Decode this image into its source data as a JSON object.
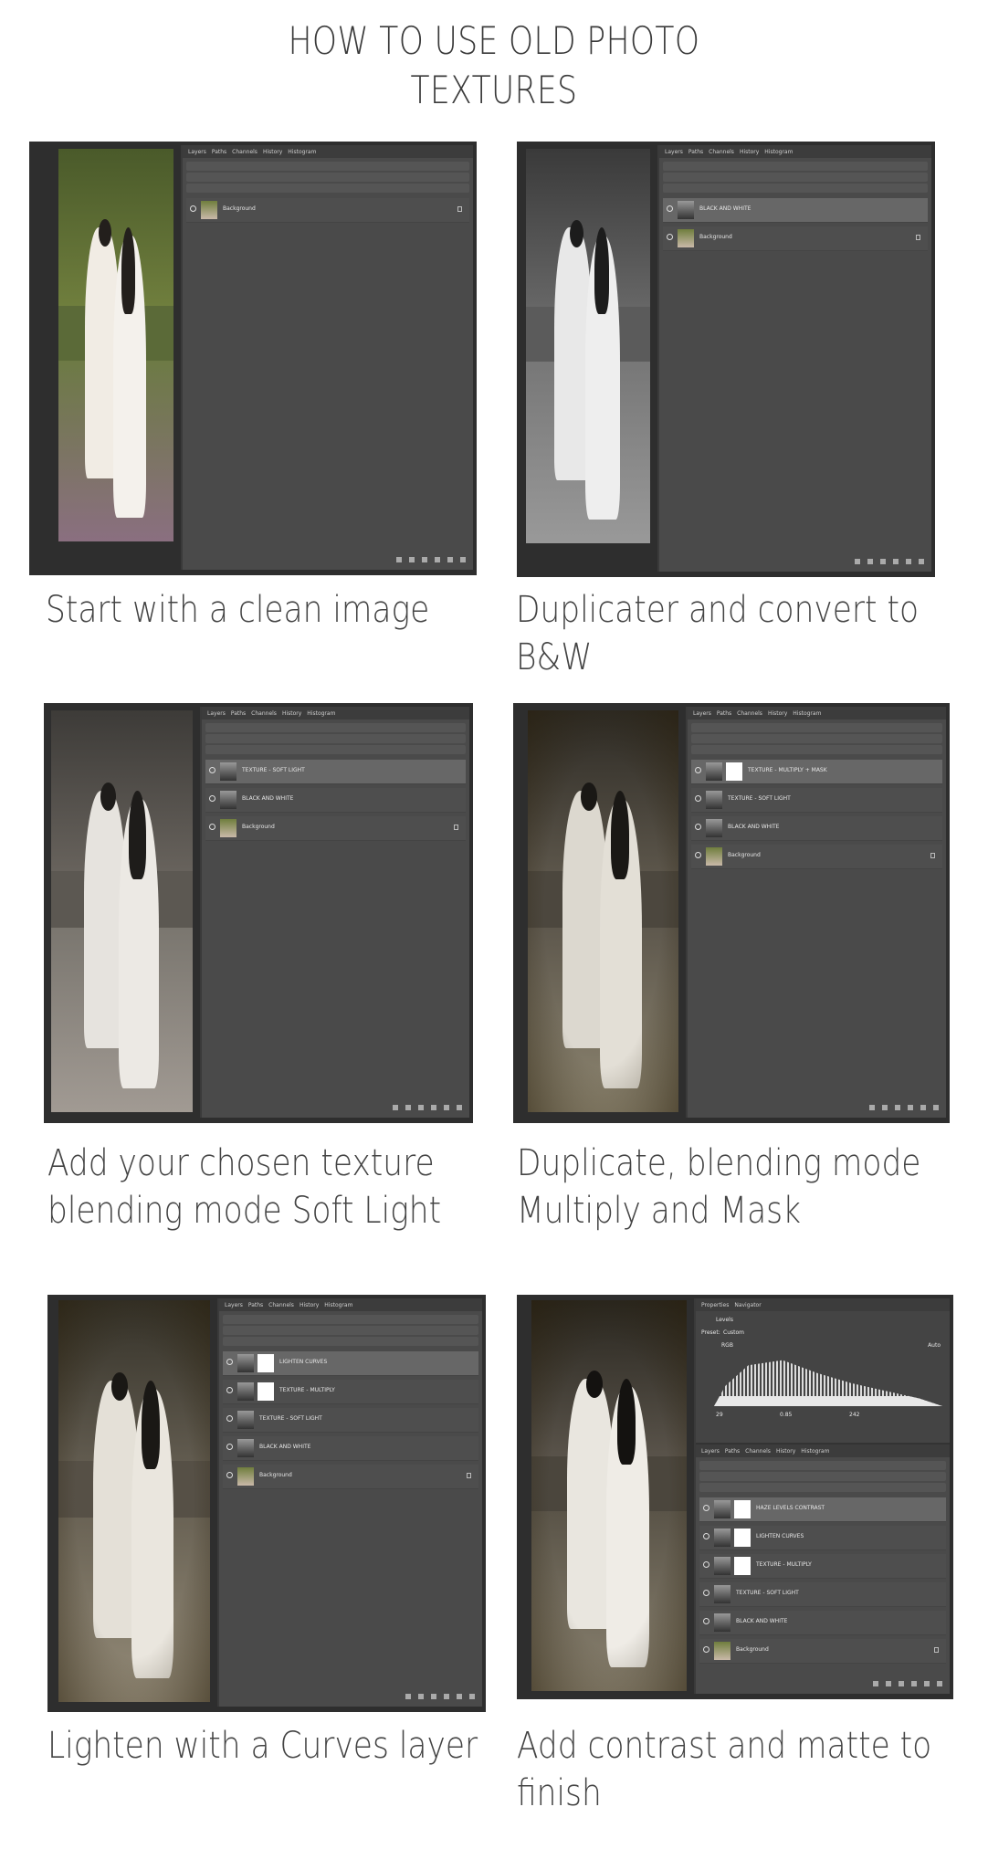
{
  "title_line1": "HOW TO USE OLD PHOTO",
  "title_line2": "TEXTURES",
  "panel_tabs": [
    "Layers",
    "Paths",
    "Channels",
    "History",
    "Histogram"
  ],
  "properties_tabs": [
    "Properties",
    "Navigator"
  ],
  "properties": {
    "section": "Levels",
    "preset_label": "Preset:",
    "preset_value": "Custom",
    "channel": "RGB",
    "auto": "Auto",
    "in_low": "29",
    "in_mid": "0.85",
    "in_high": "242"
  },
  "steps": [
    {
      "caption_line1": "Start with a clean image",
      "caption_line2": "",
      "layers": [
        "Background"
      ]
    },
    {
      "caption_line1": "Duplicater and convert to",
      "caption_line2": "B&W",
      "layers": [
        "BLACK AND WHITE",
        "Background"
      ]
    },
    {
      "caption_line1": "Add your chosen texture",
      "caption_line2": "blending mode Soft Light",
      "layers": [
        "TEXTURE - SOFT LIGHT",
        "BLACK AND WHITE",
        "Background"
      ]
    },
    {
      "caption_line1": "Duplicate, blending mode",
      "caption_line2": "Multiply and Mask",
      "layers": [
        "TEXTURE - MULTIPLY + MASK",
        "TEXTURE - SOFT LIGHT",
        "BLACK AND WHITE",
        "Background"
      ]
    },
    {
      "caption_line1": "Lighten with a Curves layer",
      "caption_line2": "",
      "layers": [
        "LIGHTEN CURVES",
        "TEXTURE - MULTIPLY",
        "TEXTURE - SOFT LIGHT",
        "BLACK AND WHITE",
        "Background"
      ]
    },
    {
      "caption_line1": "Add contrast and matte to",
      "caption_line2": "finish",
      "layers": [
        "HAZE LEVELS CONTRAST",
        "LIGHTEN CURVES",
        "TEXTURE - MULTIPLY",
        "TEXTURE - SOFT LIGHT",
        "BLACK AND WHITE",
        "Background"
      ]
    }
  ],
  "colors": {
    "panel_bg": "#4a4a4a",
    "selected_layer": "#676767",
    "frame_bg": "#2e2e2e"
  }
}
